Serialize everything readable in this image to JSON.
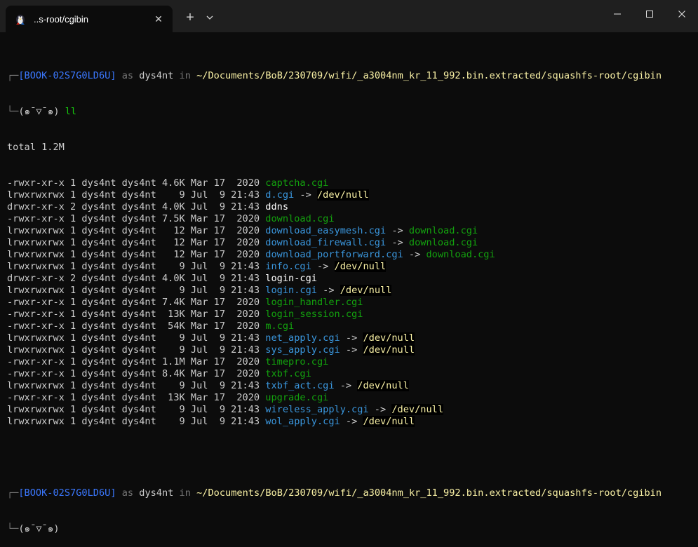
{
  "window": {
    "tab_title": "..s-root/cgibin",
    "tab_icon": "linux-penguin-icon",
    "close_tab_glyph": "✕",
    "new_tab_glyph": "+",
    "dropdown_icon": "chevron-down-icon",
    "minimize_icon": "minimize-icon",
    "maximize_icon": "maximize-icon",
    "close_icon": "close-icon"
  },
  "prompt": {
    "top_corner": "┌─",
    "bottom_corner": "└─",
    "host": "[BOOK-02S7G0LD6U]",
    "as": " as ",
    "user": "dys4nt",
    "in": " in ",
    "path": "~/Documents/BoB/230709/wifi/_a3004nm_kr_11_992.bin.extracted/squashfs-root/cgibin",
    "face": "(๑ˉ▽ˉ๑)",
    "face_idle": "(๑ˉ▽ˉ๑)"
  },
  "command": " ll",
  "total": "total 1.2M",
  "listing": [
    {
      "meta": "-rwxr-xr-x 1 dys4nt dys4nt 4.6K Mar 17  2020 ",
      "name": "captcha.cgi",
      "kind": "exec",
      "target": "",
      "target_kind": ""
    },
    {
      "meta": "lrwxrwxrwx 1 dys4nt dys4nt    9 Jul  9 21:43 ",
      "name": "d.cgi",
      "kind": "link",
      "target": "/dev/null",
      "target_kind": "broken"
    },
    {
      "meta": "drwxr-xr-x 2 dys4nt dys4nt 4.0K Jul  9 21:43 ",
      "name": "ddns",
      "kind": "dir",
      "target": "",
      "target_kind": ""
    },
    {
      "meta": "-rwxr-xr-x 1 dys4nt dys4nt 7.5K Mar 17  2020 ",
      "name": "download.cgi",
      "kind": "exec",
      "target": "",
      "target_kind": ""
    },
    {
      "meta": "lrwxrwxrwx 1 dys4nt dys4nt   12 Mar 17  2020 ",
      "name": "download_easymesh.cgi",
      "kind": "link",
      "target": "download.cgi",
      "target_kind": "exec"
    },
    {
      "meta": "lrwxrwxrwx 1 dys4nt dys4nt   12 Mar 17  2020 ",
      "name": "download_firewall.cgi",
      "kind": "link",
      "target": "download.cgi",
      "target_kind": "exec"
    },
    {
      "meta": "lrwxrwxrwx 1 dys4nt dys4nt   12 Mar 17  2020 ",
      "name": "download_portforward.cgi",
      "kind": "link",
      "target": "download.cgi",
      "target_kind": "exec"
    },
    {
      "meta": "lrwxrwxrwx 1 dys4nt dys4nt    9 Jul  9 21:43 ",
      "name": "info.cgi",
      "kind": "link",
      "target": "/dev/null",
      "target_kind": "broken"
    },
    {
      "meta": "drwxr-xr-x 2 dys4nt dys4nt 4.0K Jul  9 21:43 ",
      "name": "login-cgi",
      "kind": "dir",
      "target": "",
      "target_kind": ""
    },
    {
      "meta": "lrwxrwxrwx 1 dys4nt dys4nt    9 Jul  9 21:43 ",
      "name": "login.cgi",
      "kind": "link",
      "target": "/dev/null",
      "target_kind": "broken"
    },
    {
      "meta": "-rwxr-xr-x 1 dys4nt dys4nt 7.4K Mar 17  2020 ",
      "name": "login_handler.cgi",
      "kind": "exec",
      "target": "",
      "target_kind": ""
    },
    {
      "meta": "-rwxr-xr-x 1 dys4nt dys4nt  13K Mar 17  2020 ",
      "name": "login_session.cgi",
      "kind": "exec",
      "target": "",
      "target_kind": ""
    },
    {
      "meta": "-rwxr-xr-x 1 dys4nt dys4nt  54K Mar 17  2020 ",
      "name": "m.cgi",
      "kind": "exec",
      "target": "",
      "target_kind": ""
    },
    {
      "meta": "lrwxrwxrwx 1 dys4nt dys4nt    9 Jul  9 21:43 ",
      "name": "net_apply.cgi",
      "kind": "link",
      "target": "/dev/null",
      "target_kind": "broken"
    },
    {
      "meta": "lrwxrwxrwx 1 dys4nt dys4nt    9 Jul  9 21:43 ",
      "name": "sys_apply.cgi",
      "kind": "link",
      "target": "/dev/null",
      "target_kind": "broken"
    },
    {
      "meta": "-rwxr-xr-x 1 dys4nt dys4nt 1.1M Mar 17  2020 ",
      "name": "timepro.cgi",
      "kind": "exec",
      "target": "",
      "target_kind": ""
    },
    {
      "meta": "-rwxr-xr-x 1 dys4nt dys4nt 8.4K Mar 17  2020 ",
      "name": "txbf.cgi",
      "kind": "exec",
      "target": "",
      "target_kind": ""
    },
    {
      "meta": "lrwxrwxrwx 1 dys4nt dys4nt    9 Jul  9 21:43 ",
      "name": "txbf_act.cgi",
      "kind": "link",
      "target": "/dev/null",
      "target_kind": "broken"
    },
    {
      "meta": "-rwxr-xr-x 1 dys4nt dys4nt  13K Mar 17  2020 ",
      "name": "upgrade.cgi",
      "kind": "exec",
      "target": "",
      "target_kind": ""
    },
    {
      "meta": "lrwxrwxrwx 1 dys4nt dys4nt    9 Jul  9 21:43 ",
      "name": "wireless_apply.cgi",
      "kind": "link",
      "target": "/dev/null",
      "target_kind": "broken"
    },
    {
      "meta": "lrwxrwxrwx 1 dys4nt dys4nt    9 Jul  9 21:43 ",
      "name": "wol_apply.cgi",
      "kind": "link",
      "target": "/dev/null",
      "target_kind": "broken"
    }
  ],
  "arrow": " -> ",
  "colors": {
    "background": "#0c0c0c",
    "titlebar": "#1f1f1f",
    "host": "#3b78ff",
    "path": "#f9f1a5",
    "exec": "#13a10e",
    "link": "#3a96dd",
    "dir": "#ffffff"
  }
}
